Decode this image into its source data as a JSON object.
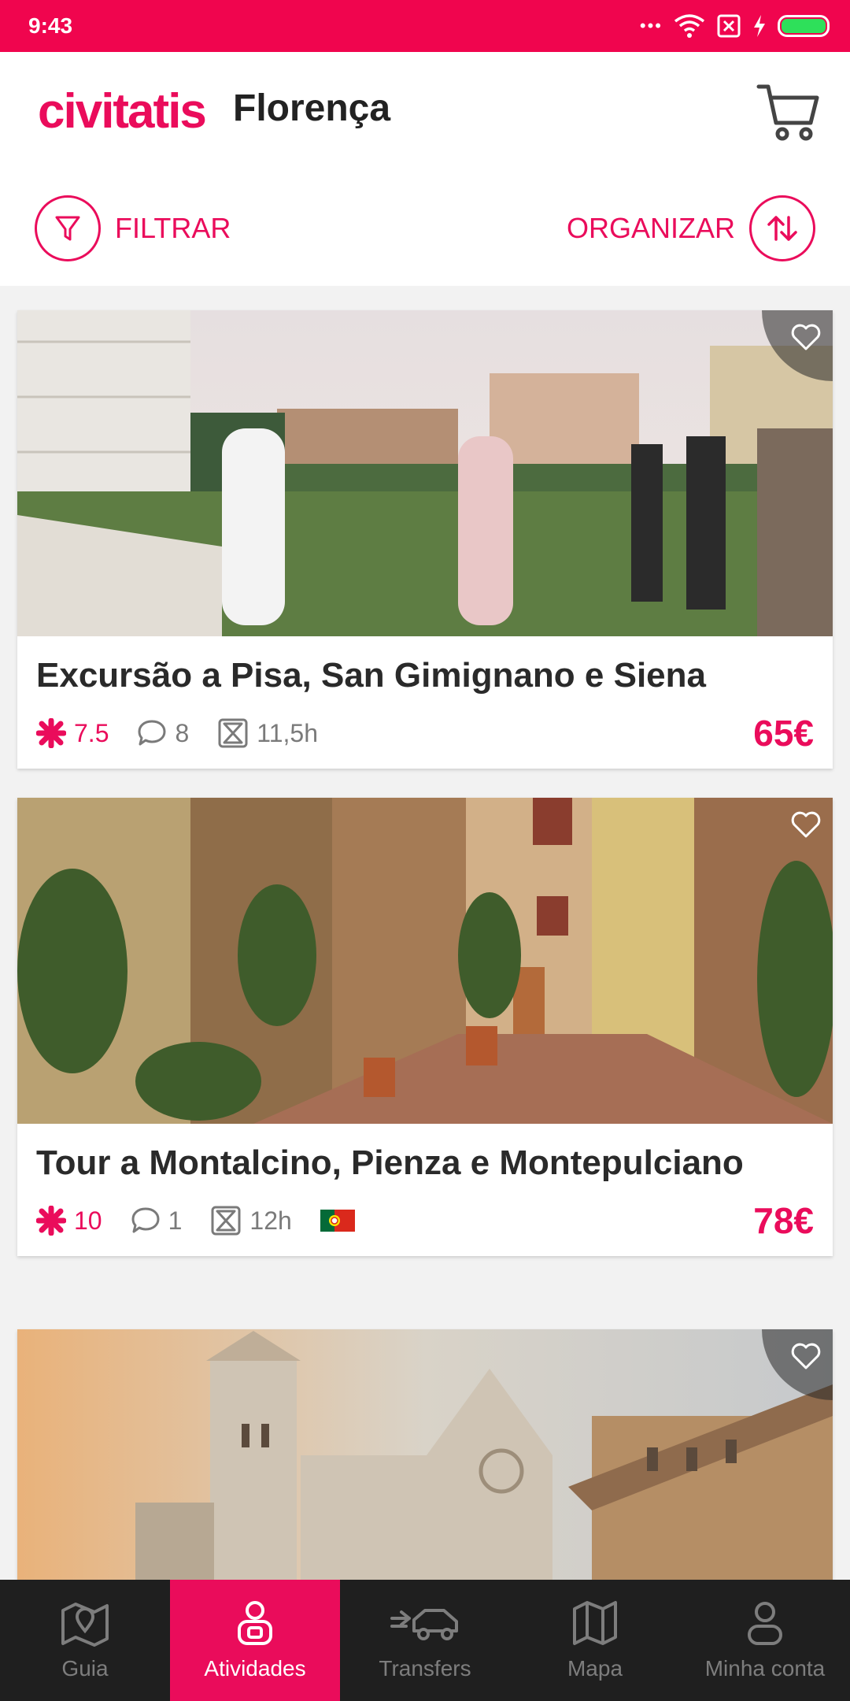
{
  "status_bar": {
    "time": "9:43",
    "dots": "•••"
  },
  "header": {
    "brand": "civitatis",
    "city": "Florença",
    "filter_label": "FILTRAR",
    "sort_label": "ORGANIZAR"
  },
  "colors": {
    "accent": "#ea0c5b",
    "status_bar": "#f0054e",
    "nav_bg": "#1f1f1f"
  },
  "cards": [
    {
      "title": "Excursão a Pisa, San Gimignano e Siena",
      "rating": "7.5",
      "comments": "8",
      "duration": "11,5h",
      "price": "65€"
    },
    {
      "title": "Tour a Montalcino, Pienza e Montepulciano",
      "rating": "10",
      "comments": "1",
      "duration": "12h",
      "price": "78€",
      "flag": "portugal-flag"
    },
    {
      "title": ""
    }
  ],
  "bottom_nav": {
    "items": [
      {
        "label": "Guia",
        "icon": "map-pin-icon"
      },
      {
        "label": "Atividades",
        "icon": "activities-icon",
        "active": true
      },
      {
        "label": "Transfers",
        "icon": "transfer-car-icon"
      },
      {
        "label": "Mapa",
        "icon": "map-icon"
      },
      {
        "label": "Minha conta",
        "icon": "user-icon"
      }
    ]
  }
}
